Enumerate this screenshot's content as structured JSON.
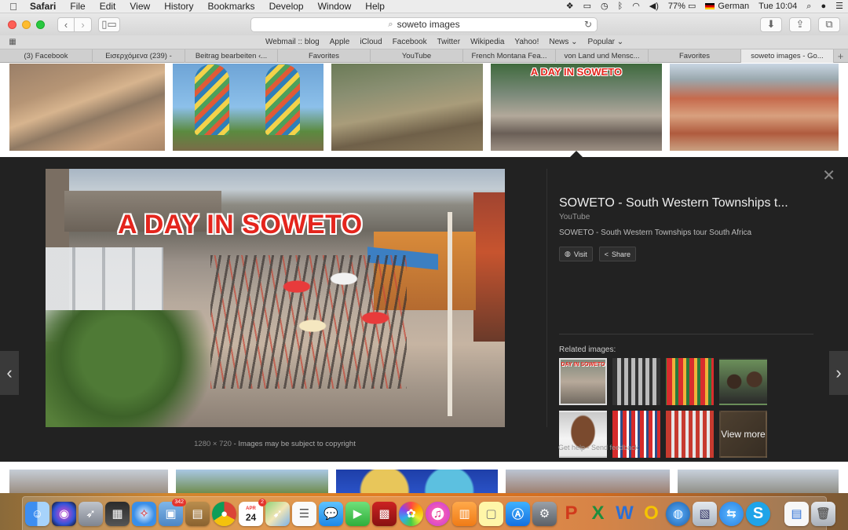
{
  "menubar": {
    "app_name": "Safari",
    "items": [
      "File",
      "Edit",
      "View",
      "History",
      "Bookmarks",
      "Develop",
      "Window",
      "Help"
    ],
    "battery": "77%",
    "input_source": "German",
    "clock": "Tue 10:04"
  },
  "toolbar": {
    "address": "soweto images"
  },
  "favorites": [
    "Webmail :: blog",
    "Apple",
    "iCloud",
    "Facebook",
    "Twitter",
    "Wikipedia",
    "Yahoo!",
    "News ⌄",
    "Popular ⌄"
  ],
  "tabs": [
    "(3) Facebook",
    "Εισερχόμενα (239) -",
    "Beitrag bearbeiten ‹...",
    "Favorites",
    "YouTube",
    "French Montana Fea...",
    "von Land und Mensc...",
    "Favorites",
    "soweto images - Go..."
  ],
  "active_tab_index": 8,
  "top_thumbs": [
    {
      "alt": "aerial view of township"
    },
    {
      "alt": "painted cooling towers"
    },
    {
      "alt": "informal settlement shacks"
    },
    {
      "alt": "market street",
      "overlay": "A DAY IN SOWETO"
    },
    {
      "alt": "rooftops of houses"
    }
  ],
  "preview": {
    "image_title_overlay": "A DAY IN SOWETO",
    "dimensions": "1280 × 720",
    "copyright_note": "Images may be subject to copyright",
    "title": "SOWETO - South Western Townships t...",
    "source": "YouTube",
    "description": "SOWETO - South Western Townships tour South Africa",
    "visit_label": "Visit",
    "share_label": "Share",
    "related_label": "Related images:",
    "view_more_label": "View more",
    "related_selected_overlay": "DAY IN SOWETO",
    "footer_get_help": "Get help",
    "footer_separator": " - ",
    "footer_send_feedback": "Send feedback"
  },
  "dock": {
    "icons": [
      "finder",
      "siri",
      "launchpad",
      "mission-control",
      "safari",
      "photos-viewer",
      "notes-book",
      "chrome",
      "calendar",
      "maps",
      "reminders",
      "messages",
      "facetime",
      "photo-booth",
      "photos",
      "itunes",
      "ibooks",
      "stickies",
      "app-store",
      "system-preferences",
      "powerpoint",
      "excel",
      "word",
      "outlook",
      "network-utility",
      "preview",
      "team-viewer",
      "skype",
      "documents",
      "trash"
    ],
    "calendar_month": "APR",
    "calendar_day": "24",
    "calendar_badge": "2",
    "photos_badge": "342"
  }
}
